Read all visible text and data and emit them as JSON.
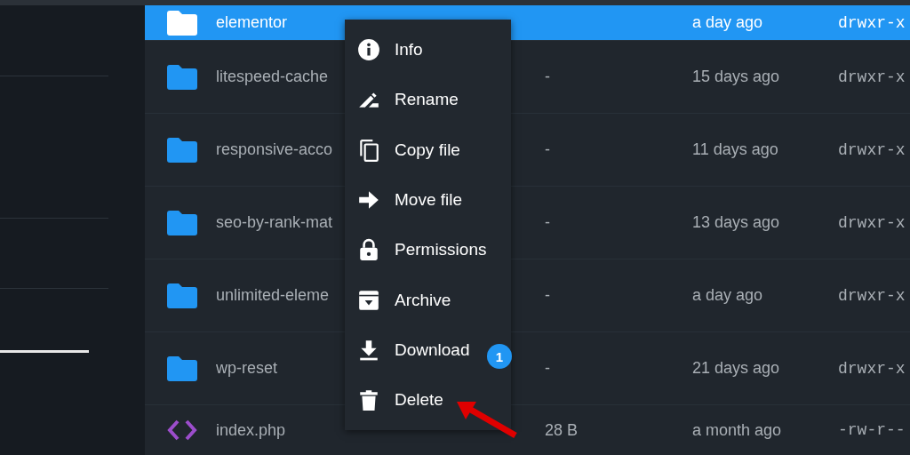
{
  "files": [
    {
      "kind": "folder",
      "name": "elementor",
      "modified": "a day ago",
      "permissions": "drwxr-x",
      "selected": true
    },
    {
      "kind": "folder",
      "name": "litespeed-cache",
      "size": "-",
      "modified": "15 days ago",
      "permissions": "drwxr-x",
      "selected": false
    },
    {
      "kind": "folder",
      "name": "responsive-acco",
      "size": "-",
      "modified": "11 days ago",
      "permissions": "drwxr-x",
      "selected": false
    },
    {
      "kind": "folder",
      "name": "seo-by-rank-mat",
      "size": "-",
      "modified": "13 days ago",
      "permissions": "drwxr-x",
      "selected": false
    },
    {
      "kind": "folder",
      "name": "unlimited-eleme",
      "size": "-",
      "modified": "a day ago",
      "permissions": "drwxr-x",
      "selected": false
    },
    {
      "kind": "folder",
      "name": "wp-reset",
      "size": "-",
      "modified": "21 days ago",
      "permissions": "drwxr-x",
      "selected": false
    },
    {
      "kind": "code",
      "name": "index.php",
      "size": "28 B",
      "modified": "a month ago",
      "permissions": "-rw-r--",
      "selected": false
    }
  ],
  "context_menu": {
    "items": [
      {
        "kind": "info",
        "label": "Info"
      },
      {
        "kind": "rename",
        "label": "Rename"
      },
      {
        "kind": "copy",
        "label": "Copy file"
      },
      {
        "kind": "move",
        "label": "Move file"
      },
      {
        "kind": "permissions",
        "label": "Permissions"
      },
      {
        "kind": "archive",
        "label": "Archive"
      },
      {
        "kind": "download",
        "label": "Download"
      },
      {
        "kind": "delete",
        "label": "Delete"
      }
    ]
  },
  "badge": "1"
}
